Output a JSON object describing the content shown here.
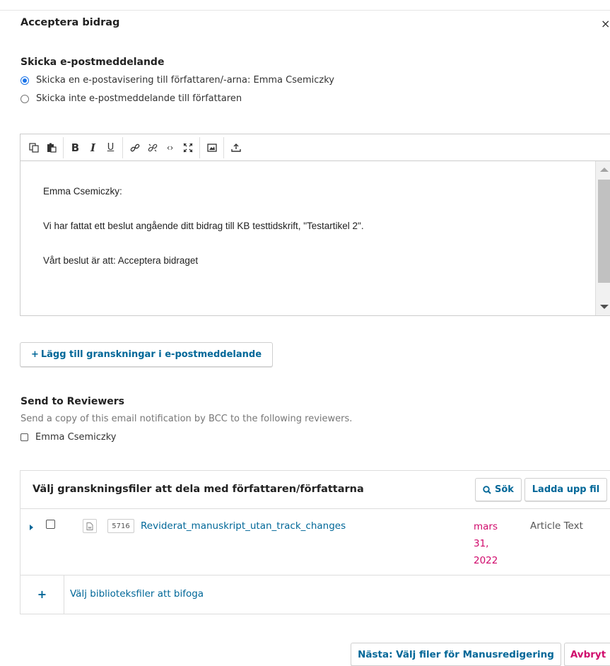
{
  "modal": {
    "title": "Acceptera bidrag",
    "close_glyph": "×"
  },
  "email_section": {
    "title": "Skicka e-postmeddelande",
    "options": [
      {
        "label": "Skicka en e-postavisering till författaren/-arna: Emma Csemiczky",
        "checked": true
      },
      {
        "label": "Skicka inte e-postmeddelande till författaren",
        "checked": false
      }
    ]
  },
  "editor": {
    "toolbar_icons": [
      "copy-icon",
      "paste-icon",
      "bold-icon",
      "italic-icon",
      "underline-icon",
      "link-icon",
      "unlink-icon",
      "code-icon",
      "fullscreen-icon",
      "image-icon",
      "upload-icon"
    ],
    "toolbar_glyphs": {
      "bold": "B",
      "italic": "I",
      "underline": "U",
      "code": "‹›"
    },
    "lines": [
      "Emma Csemiczky:",
      "Vi har fattat ett beslut angående ditt bidrag till KB testtidskrift, \"Testartikel 2\".",
      "Vårt beslut är att: Acceptera bidraget"
    ]
  },
  "add_reviews_button": {
    "plus": "+",
    "label": "Lägg till granskningar i e-postmeddelande"
  },
  "reviewers": {
    "title": "Send to Reviewers",
    "description": "Send a copy of this email notification by BCC to the following reviewers.",
    "items": [
      {
        "name": "Emma Csemiczky",
        "checked": false
      }
    ]
  },
  "files": {
    "title": "Välj granskningsfiler att dela med författaren/författarna",
    "search_label": "Sök",
    "upload_label": "Ladda upp fil",
    "rows": [
      {
        "id": "5716",
        "name": "Reviderat_manuskript_utan_track_changes",
        "date_parts": [
          "mars",
          "31,",
          "2022"
        ],
        "genre": "Article Text",
        "checked": false
      }
    ],
    "library_plus": "+",
    "library_label": "Välj biblioteksfiler att bifoga"
  },
  "footer": {
    "next_label": "Nästa: Välj filer för Manusredigering",
    "cancel_label": "Avbryt"
  },
  "colors": {
    "link": "#006798",
    "accent_radio": "#1a73e8",
    "date": "#d00a6c",
    "cancel": "#d00a6c"
  }
}
